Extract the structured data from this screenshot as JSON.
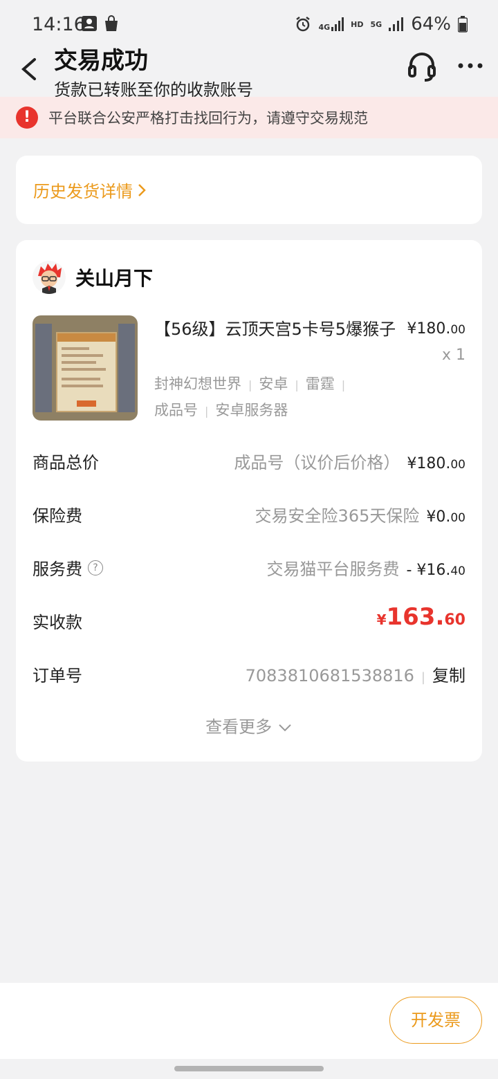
{
  "status_bar": {
    "time": "14:16",
    "battery": "64%",
    "net1": "4G",
    "net2": "HD",
    "net3": "5G"
  },
  "header": {
    "title": "交易成功",
    "subtitle": "货款已转账至你的收款账号",
    "icons": [
      "back-arrow-icon",
      "headset-icon",
      "more-icon"
    ]
  },
  "notice": {
    "icon": "!",
    "text": "平台联合公安严格打击找回行为，请遵守交易规范"
  },
  "history": {
    "label": "历史发货详情"
  },
  "order": {
    "seller_name": "关山月下",
    "product": {
      "title": "【56级】云顶天宫5卡号5爆猴子",
      "price_int": "¥180.",
      "price_dec": "00",
      "qty": "x 1",
      "tags_line1": [
        "封神幻想世界",
        "安卓",
        "雷霆"
      ],
      "tags_line2": [
        "成品号",
        "安卓服务器"
      ]
    },
    "rows": {
      "total": {
        "label": "商品总价",
        "desc": "成品号（议价后价格）",
        "int": "¥180.",
        "dec": "00"
      },
      "insurance": {
        "label": "保险费",
        "desc": "交易安全险365天保险",
        "int": "¥0.",
        "dec": "00"
      },
      "service": {
        "label": "服务费",
        "help": "?",
        "desc": "交易猫平台服务费",
        "int": "- ¥16.",
        "dec": "40"
      },
      "received": {
        "label": "实收款",
        "cur": "¥",
        "int": "163.",
        "dec": "60"
      },
      "order_no": {
        "label": "订单号",
        "value": "7083810681538816",
        "sep": "|",
        "copy": "复制"
      }
    },
    "see_more": "查看更多"
  },
  "bottom": {
    "invoice_button": "开发票"
  },
  "colors": {
    "accent": "#eb9a1c",
    "danger": "#e8342d",
    "notice_bg": "#fbe9e8"
  }
}
